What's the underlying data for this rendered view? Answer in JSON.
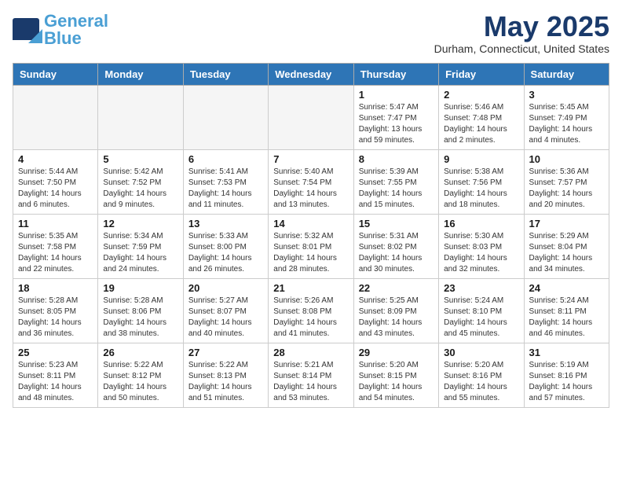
{
  "header": {
    "logo_general": "General",
    "logo_blue": "Blue",
    "month_title": "May 2025",
    "location": "Durham, Connecticut, United States"
  },
  "weekdays": [
    "Sunday",
    "Monday",
    "Tuesday",
    "Wednesday",
    "Thursday",
    "Friday",
    "Saturday"
  ],
  "weeks": [
    [
      {
        "day": "",
        "empty": true
      },
      {
        "day": "",
        "empty": true
      },
      {
        "day": "",
        "empty": true
      },
      {
        "day": "",
        "empty": true
      },
      {
        "day": "1",
        "sunrise": "5:47 AM",
        "sunset": "7:47 PM",
        "daylight": "13 hours and 59 minutes."
      },
      {
        "day": "2",
        "sunrise": "5:46 AM",
        "sunset": "7:48 PM",
        "daylight": "14 hours and 2 minutes."
      },
      {
        "day": "3",
        "sunrise": "5:45 AM",
        "sunset": "7:49 PM",
        "daylight": "14 hours and 4 minutes."
      }
    ],
    [
      {
        "day": "4",
        "sunrise": "5:44 AM",
        "sunset": "7:50 PM",
        "daylight": "14 hours and 6 minutes."
      },
      {
        "day": "5",
        "sunrise": "5:42 AM",
        "sunset": "7:52 PM",
        "daylight": "14 hours and 9 minutes."
      },
      {
        "day": "6",
        "sunrise": "5:41 AM",
        "sunset": "7:53 PM",
        "daylight": "14 hours and 11 minutes."
      },
      {
        "day": "7",
        "sunrise": "5:40 AM",
        "sunset": "7:54 PM",
        "daylight": "14 hours and 13 minutes."
      },
      {
        "day": "8",
        "sunrise": "5:39 AM",
        "sunset": "7:55 PM",
        "daylight": "14 hours and 15 minutes."
      },
      {
        "day": "9",
        "sunrise": "5:38 AM",
        "sunset": "7:56 PM",
        "daylight": "14 hours and 18 minutes."
      },
      {
        "day": "10",
        "sunrise": "5:36 AM",
        "sunset": "7:57 PM",
        "daylight": "14 hours and 20 minutes."
      }
    ],
    [
      {
        "day": "11",
        "sunrise": "5:35 AM",
        "sunset": "7:58 PM",
        "daylight": "14 hours and 22 minutes."
      },
      {
        "day": "12",
        "sunrise": "5:34 AM",
        "sunset": "7:59 PM",
        "daylight": "14 hours and 24 minutes."
      },
      {
        "day": "13",
        "sunrise": "5:33 AM",
        "sunset": "8:00 PM",
        "daylight": "14 hours and 26 minutes."
      },
      {
        "day": "14",
        "sunrise": "5:32 AM",
        "sunset": "8:01 PM",
        "daylight": "14 hours and 28 minutes."
      },
      {
        "day": "15",
        "sunrise": "5:31 AM",
        "sunset": "8:02 PM",
        "daylight": "14 hours and 30 minutes."
      },
      {
        "day": "16",
        "sunrise": "5:30 AM",
        "sunset": "8:03 PM",
        "daylight": "14 hours and 32 minutes."
      },
      {
        "day": "17",
        "sunrise": "5:29 AM",
        "sunset": "8:04 PM",
        "daylight": "14 hours and 34 minutes."
      }
    ],
    [
      {
        "day": "18",
        "sunrise": "5:28 AM",
        "sunset": "8:05 PM",
        "daylight": "14 hours and 36 minutes."
      },
      {
        "day": "19",
        "sunrise": "5:28 AM",
        "sunset": "8:06 PM",
        "daylight": "14 hours and 38 minutes."
      },
      {
        "day": "20",
        "sunrise": "5:27 AM",
        "sunset": "8:07 PM",
        "daylight": "14 hours and 40 minutes."
      },
      {
        "day": "21",
        "sunrise": "5:26 AM",
        "sunset": "8:08 PM",
        "daylight": "14 hours and 41 minutes."
      },
      {
        "day": "22",
        "sunrise": "5:25 AM",
        "sunset": "8:09 PM",
        "daylight": "14 hours and 43 minutes."
      },
      {
        "day": "23",
        "sunrise": "5:24 AM",
        "sunset": "8:10 PM",
        "daylight": "14 hours and 45 minutes."
      },
      {
        "day": "24",
        "sunrise": "5:24 AM",
        "sunset": "8:11 PM",
        "daylight": "14 hours and 46 minutes."
      }
    ],
    [
      {
        "day": "25",
        "sunrise": "5:23 AM",
        "sunset": "8:11 PM",
        "daylight": "14 hours and 48 minutes."
      },
      {
        "day": "26",
        "sunrise": "5:22 AM",
        "sunset": "8:12 PM",
        "daylight": "14 hours and 50 minutes."
      },
      {
        "day": "27",
        "sunrise": "5:22 AM",
        "sunset": "8:13 PM",
        "daylight": "14 hours and 51 minutes."
      },
      {
        "day": "28",
        "sunrise": "5:21 AM",
        "sunset": "8:14 PM",
        "daylight": "14 hours and 53 minutes."
      },
      {
        "day": "29",
        "sunrise": "5:20 AM",
        "sunset": "8:15 PM",
        "daylight": "14 hours and 54 minutes."
      },
      {
        "day": "30",
        "sunrise": "5:20 AM",
        "sunset": "8:16 PM",
        "daylight": "14 hours and 55 minutes."
      },
      {
        "day": "31",
        "sunrise": "5:19 AM",
        "sunset": "8:16 PM",
        "daylight": "14 hours and 57 minutes."
      }
    ]
  ]
}
